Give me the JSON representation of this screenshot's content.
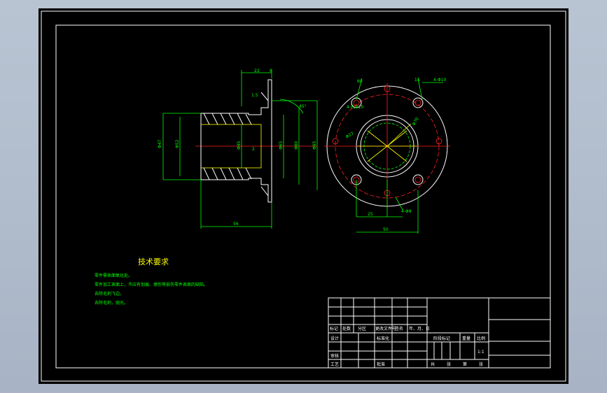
{
  "colors": {
    "background": "#000000",
    "frame": "#ffffff",
    "dimension": "#00ff00",
    "centerline": "#ff2020",
    "outline": "#ffff00"
  },
  "section_view": {
    "dims": {
      "top_a": "22",
      "top_b": "8",
      "thickness": "1.5",
      "angle": "45°",
      "d_outer_left": "Φ47",
      "d_inner_left": "Φ52",
      "d_bore": "Φ45",
      "d_mid": "Φ65",
      "d_hub": "Φ80",
      "d_flange": "Φ95",
      "step": "2",
      "length": "56"
    }
  },
  "end_view": {
    "dims": {
      "angle_top_left": "60",
      "angle_top": "15",
      "holes_top": "4-Φ10",
      "note_left": "4-孔Φ10",
      "d_bolt": "Φ70",
      "d_bore": "Φ27",
      "width_a": "25",
      "holes_bottom": "4-Φ8",
      "width_b": "50"
    }
  },
  "tech_req": {
    "title": "技术要求",
    "lines": [
      "零件需表面氧化处。",
      "零件加工表面上，不应有划痕、擦伤等损伤零件表面的缺陷。",
      "去除毛刺飞边。",
      "去除毛刺，抛光。"
    ]
  },
  "title_block": {
    "header": [
      "标记",
      "处数",
      "分区",
      "更改文件号",
      "签名",
      "年、月、日"
    ],
    "design": "设计",
    "standard": "标准化",
    "review": "审核",
    "process": "工艺",
    "approve": "批准",
    "stage": "阶段标记",
    "weight": "重量",
    "scale": "比例",
    "scale_value": "1:1",
    "sheets": [
      "共",
      "张",
      "第",
      "张"
    ]
  }
}
